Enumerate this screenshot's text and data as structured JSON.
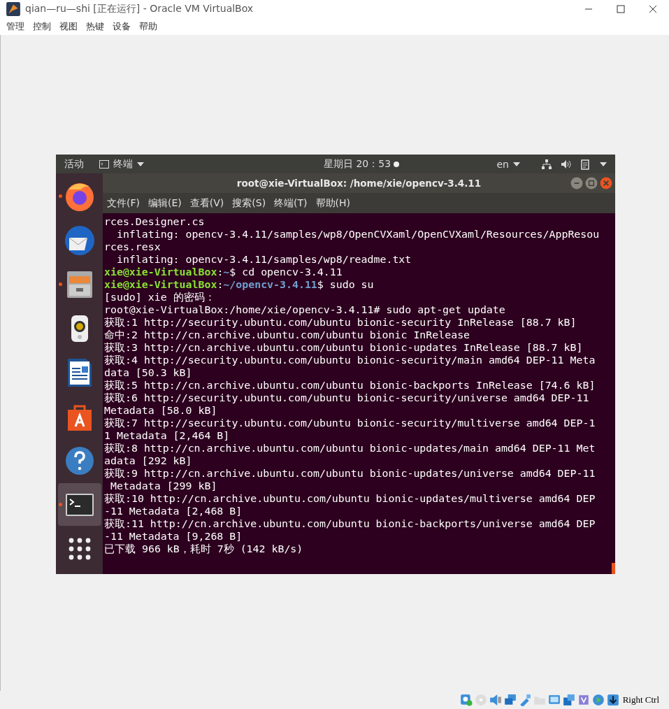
{
  "window": {
    "title": "qian—ru—shi [正在运行] - Oracle VM VirtualBox"
  },
  "menu": [
    "管理",
    "控制",
    "视图",
    "热键",
    "设备",
    "帮助"
  ],
  "top_panel": {
    "activities": "活动",
    "app": "终端",
    "clock": "星期日 20：53",
    "language": "en"
  },
  "dock": [
    {
      "kind": "browser",
      "running": true,
      "selected": false
    },
    {
      "kind": "mail",
      "running": false,
      "selected": false
    },
    {
      "kind": "files",
      "running": true,
      "selected": false
    },
    {
      "kind": "music",
      "running": false,
      "selected": false
    },
    {
      "kind": "writer",
      "running": false,
      "selected": false
    },
    {
      "kind": "store",
      "running": false,
      "selected": false
    },
    {
      "kind": "help",
      "running": false,
      "selected": false
    },
    {
      "kind": "terminal",
      "running": true,
      "selected": true
    },
    {
      "kind": "apps",
      "running": false,
      "selected": false
    }
  ],
  "terminal": {
    "title": "root@xie-VirtualBox: /home/xie/opencv-3.4.11",
    "menu": [
      "文件(F)",
      "编辑(E)",
      "查看(V)",
      "搜索(S)",
      "终端(T)",
      "帮助(H)"
    ],
    "lines": [
      [
        {
          "kind": "text",
          "text": "rces.Designer.cs"
        }
      ],
      [
        {
          "kind": "text",
          "text": "  inflating: opencv-3.4.11/samples/wp8/OpenCVXaml/OpenCVXaml/Resources/AppResou"
        }
      ],
      [
        {
          "kind": "text",
          "text": "rces.resx"
        }
      ],
      [
        {
          "kind": "text",
          "text": "  inflating: opencv-3.4.11/samples/wp8/readme.txt"
        }
      ],
      [
        {
          "kind": "user",
          "text": "xie@xie-VirtualBox"
        },
        {
          "kind": "text",
          "text": ":"
        },
        {
          "kind": "path",
          "text": "~"
        },
        {
          "kind": "text",
          "text": "$ cd opencv-3.4.11"
        }
      ],
      [
        {
          "kind": "user",
          "text": "xie@xie-VirtualBox"
        },
        {
          "kind": "text",
          "text": ":"
        },
        {
          "kind": "path",
          "text": "~/opencv-3.4.11"
        },
        {
          "kind": "text",
          "text": "$ sudo su"
        }
      ],
      [
        {
          "kind": "text",
          "text": "[sudo] xie 的密码："
        }
      ],
      [
        {
          "kind": "text",
          "text": "root@xie-VirtualBox:/home/xie/opencv-3.4.11# sudo apt-get update"
        }
      ],
      [
        {
          "kind": "text",
          "text": "获取:1 http://security.ubuntu.com/ubuntu bionic-security InRelease [88.7 kB]"
        }
      ],
      [
        {
          "kind": "text",
          "text": "命中:2 http://cn.archive.ubuntu.com/ubuntu bionic InRelease"
        }
      ],
      [
        {
          "kind": "text",
          "text": "获取:3 http://cn.archive.ubuntu.com/ubuntu bionic-updates InRelease [88.7 kB]"
        }
      ],
      [
        {
          "kind": "text",
          "text": "获取:4 http://security.ubuntu.com/ubuntu bionic-security/main amd64 DEP-11 Meta"
        }
      ],
      [
        {
          "kind": "text",
          "text": "data [50.3 kB]"
        }
      ],
      [
        {
          "kind": "text",
          "text": "获取:5 http://cn.archive.ubuntu.com/ubuntu bionic-backports InRelease [74.6 kB]"
        }
      ],
      [
        {
          "kind": "text",
          "text": "获取:6 http://security.ubuntu.com/ubuntu bionic-security/universe amd64 DEP-11"
        }
      ],
      [
        {
          "kind": "text",
          "text": "Metadata [58.0 kB]"
        }
      ],
      [
        {
          "kind": "text",
          "text": "获取:7 http://security.ubuntu.com/ubuntu bionic-security/multiverse amd64 DEP-1"
        }
      ],
      [
        {
          "kind": "text",
          "text": "1 Metadata [2,464 B]"
        }
      ],
      [
        {
          "kind": "text",
          "text": "获取:8 http://cn.archive.ubuntu.com/ubuntu bionic-updates/main amd64 DEP-11 Met"
        }
      ],
      [
        {
          "kind": "text",
          "text": "adata [292 kB]"
        }
      ],
      [
        {
          "kind": "text",
          "text": "获取:9 http://cn.archive.ubuntu.com/ubuntu bionic-updates/universe amd64 DEP-11"
        }
      ],
      [
        {
          "kind": "text",
          "text": " Metadata [299 kB]"
        }
      ],
      [
        {
          "kind": "text",
          "text": "获取:10 http://cn.archive.ubuntu.com/ubuntu bionic-updates/multiverse amd64 DEP"
        }
      ],
      [
        {
          "kind": "text",
          "text": "-11 Metadata [2,468 B]"
        }
      ],
      [
        {
          "kind": "text",
          "text": "获取:11 http://cn.archive.ubuntu.com/ubuntu bionic-backports/universe amd64 DEP"
        }
      ],
      [
        {
          "kind": "text",
          "text": "-11 Metadata [9,268 B]"
        }
      ],
      [
        {
          "kind": "text",
          "text": "已下载 966 kB，耗时 7秒 (142 kB/s)"
        }
      ]
    ]
  },
  "status_bar": {
    "host_key": "Right Ctrl"
  }
}
